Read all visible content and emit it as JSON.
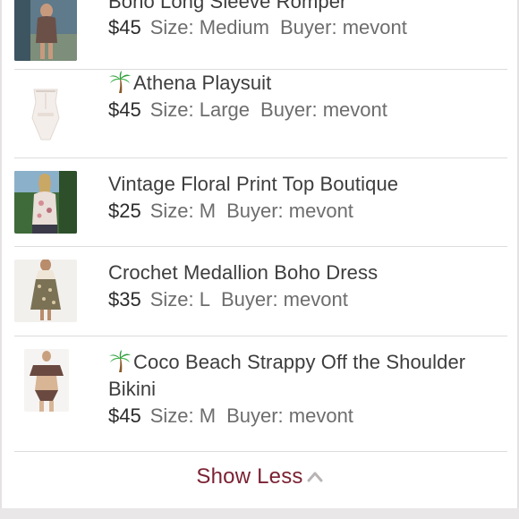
{
  "listings": [
    {
      "title": "Boho Long Sleeve Romper",
      "price": "$45",
      "size": "Size: Medium",
      "buyer": "Buyer: mevont",
      "icon": "none",
      "thumb": "woman-in-romper"
    },
    {
      "title": "Athena Playsuit",
      "price": "$45",
      "size": "Size: Large",
      "buyer": "Buyer: mevont",
      "icon": "palm-tree-icon",
      "thumb": "white-playsuit"
    },
    {
      "title": "Vintage Floral Print Top Boutique",
      "price": "$25",
      "size": "Size: M",
      "buyer": "Buyer: mevont",
      "icon": "none",
      "thumb": "woman-in-floral-top"
    },
    {
      "title": "Crochet Medallion Boho Dress",
      "price": "$35",
      "size": "Size: L",
      "buyer": "Buyer: mevont",
      "icon": "none",
      "thumb": "woman-in-boho-dress"
    },
    {
      "title": "Coco Beach Strappy Off the Shoulder Bikini",
      "price": "$45",
      "size": "Size: M",
      "buyer": "Buyer: mevont",
      "icon": "palm-tree-icon",
      "thumb": "brown-bikini"
    }
  ],
  "show_less_label": "Show Less",
  "colors": {
    "accent": "#7b2233",
    "title_text": "#3d3d3d",
    "meta_text": "#6d6d6d",
    "divider": "#dcdcdc"
  }
}
